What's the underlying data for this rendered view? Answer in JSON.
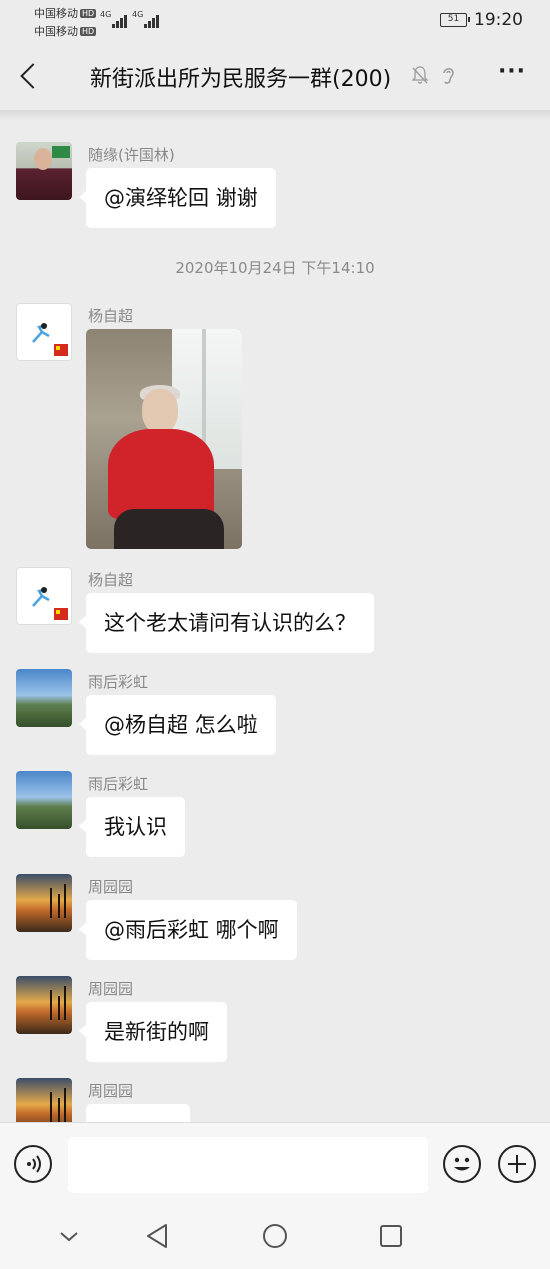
{
  "status_bar": {
    "carrier_1": "中国移动",
    "carrier_2": "中国移动",
    "hd_badge": "HD",
    "network_1": "4G",
    "network_2": "4G",
    "battery_level": "51",
    "time": "19:20"
  },
  "header": {
    "title": "新街派出所为民服务一群(200)",
    "icons": [
      "back-icon",
      "mute-bell-icon",
      "ear-icon",
      "more-icon"
    ]
  },
  "messages": [
    {
      "sender": "随缘(许国林)",
      "type": "text",
      "text": "@演绎轮回  谢谢",
      "avatar": "man-photo"
    },
    {
      "type": "timestamp",
      "text": "2020年10月24日 下午14:10"
    },
    {
      "sender": "杨自超",
      "type": "image",
      "image_desc_icon": "photo-elderly-woman",
      "avatar": "cartoon-flag"
    },
    {
      "sender": "杨自超",
      "type": "text",
      "text": "这个老太请问有认识的么？",
      "avatar": "cartoon-flag"
    },
    {
      "sender": "雨后彩虹",
      "type": "text",
      "text": "@杨自超  怎么啦",
      "avatar": "landscape-sky"
    },
    {
      "sender": "雨后彩虹",
      "type": "text",
      "text": "我认识",
      "avatar": "landscape-sky"
    },
    {
      "sender": "周园园",
      "type": "text",
      "text": "@雨后彩虹  哪个啊",
      "avatar": "sunset-palms"
    },
    {
      "sender": "周园园",
      "type": "text",
      "text": "是新街的啊",
      "avatar": "sunset-palms"
    },
    {
      "sender": "周园园",
      "type": "text",
      "text": "",
      "avatar": "sunset-palms"
    }
  ],
  "input_bar": {
    "value": "",
    "placeholder": ""
  },
  "colors": {
    "background": "#ececec",
    "bubble": "#ffffff",
    "sender_name": "#888888"
  }
}
